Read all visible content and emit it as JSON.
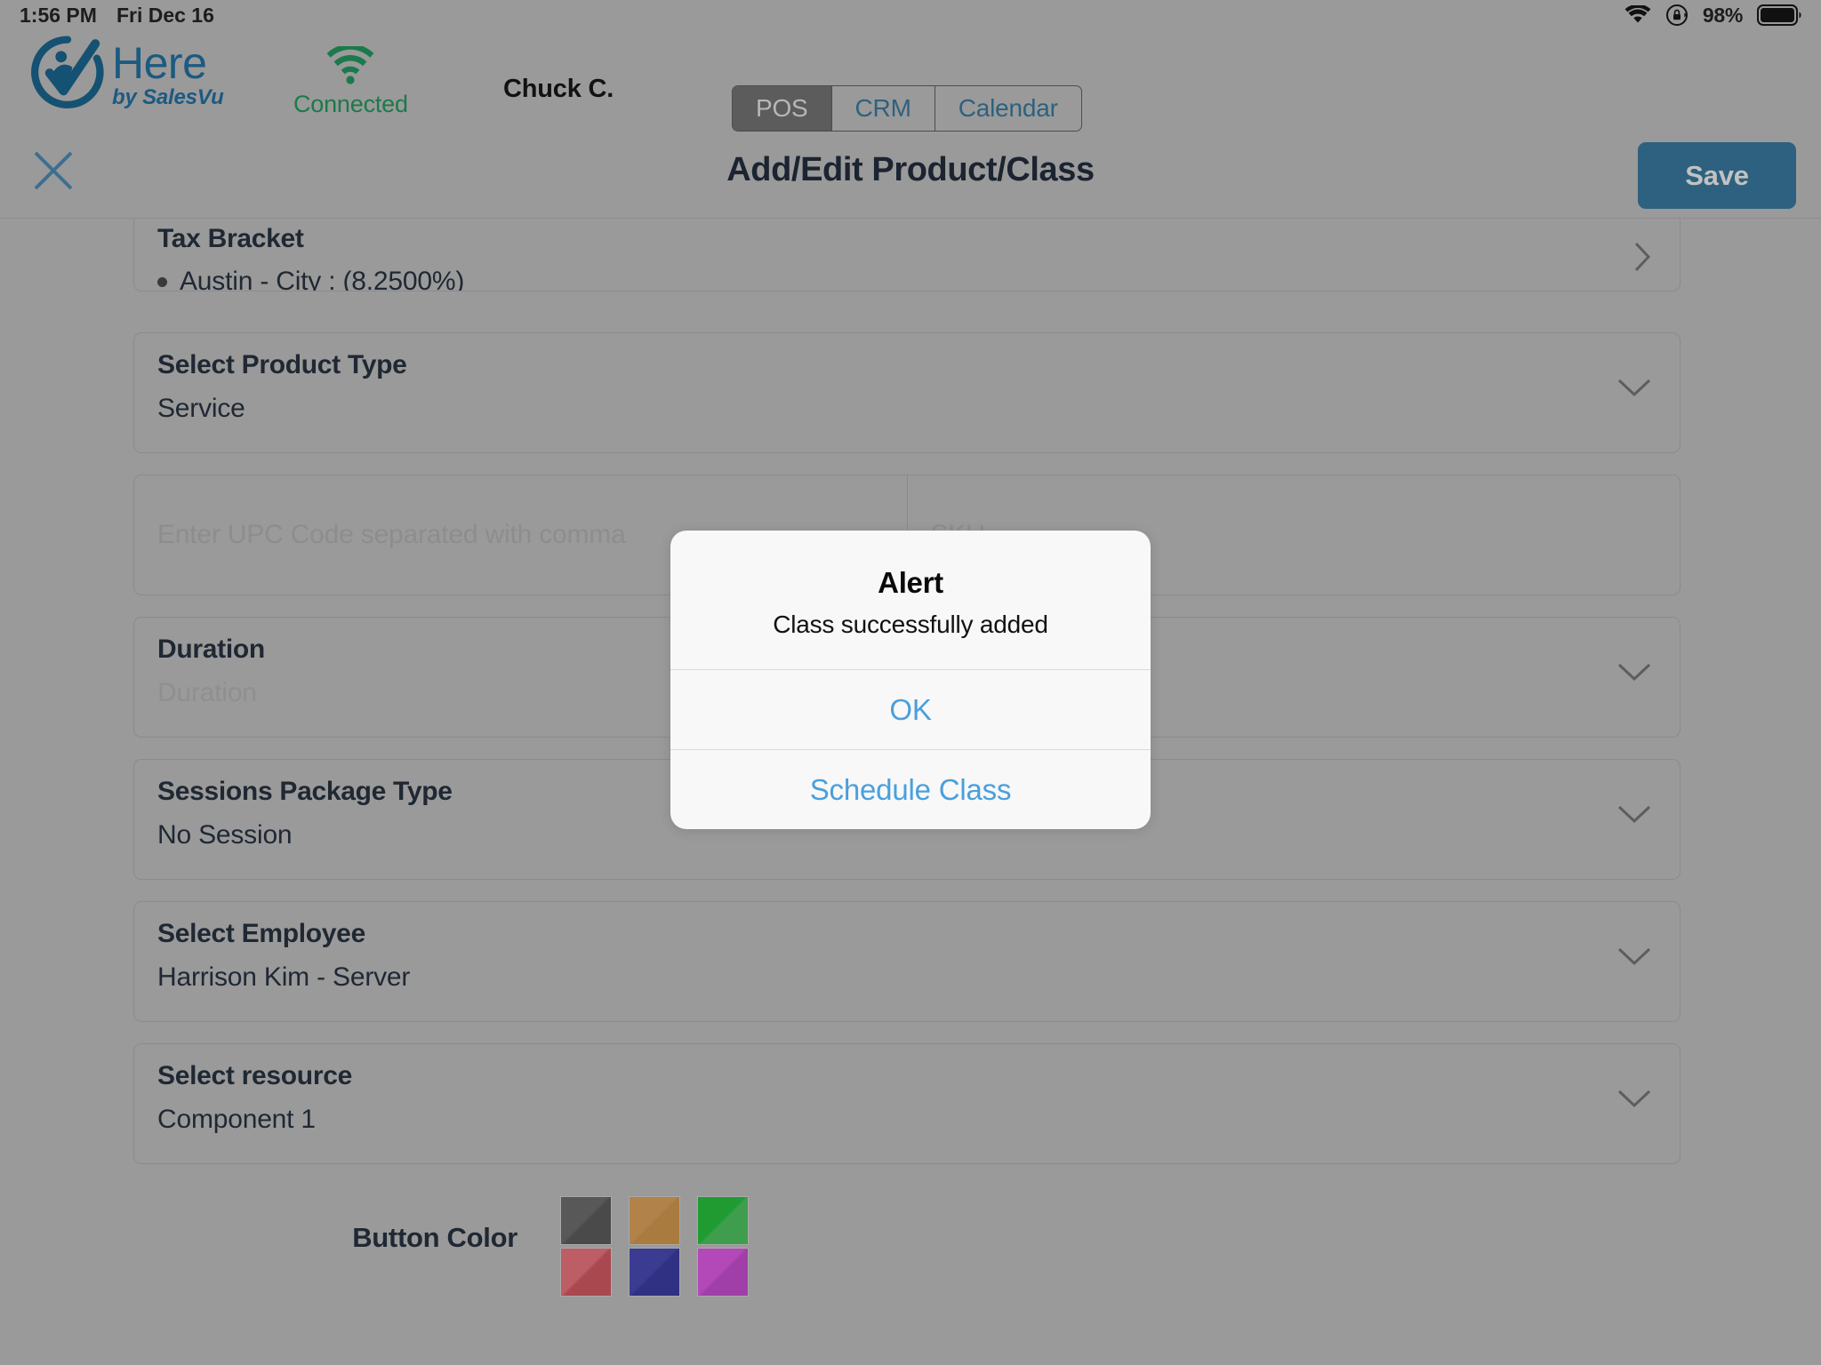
{
  "status_bar": {
    "time": "1:56 PM",
    "date": "Fri Dec 16",
    "wifi_icon": "wifi-icon",
    "rotation_lock_icon": "rotation-lock-icon",
    "battery_percent": "98%",
    "battery_icon": "battery-full-icon"
  },
  "top_bar": {
    "logo_name": "Here",
    "logo_tagline": "by SalesVu",
    "logo_icon": "here-salesvu-logo-icon",
    "connection": {
      "icon": "wifi-signal-icon",
      "label": "Connected",
      "color": "#1b7a4b"
    },
    "user_name": "Chuck C.",
    "segments": [
      {
        "label": "POS",
        "active": true
      },
      {
        "label": "CRM",
        "active": false
      },
      {
        "label": "Calendar",
        "active": false
      }
    ]
  },
  "nav_header": {
    "close_icon": "close-x-icon",
    "title": "Add/Edit Product/Class",
    "save_label": "Save",
    "save_color": "#2d617f"
  },
  "form": {
    "tax_bracket": {
      "label": "Tax Bracket",
      "value": "Austin - City : (8.2500%)",
      "chevron": "chevron-right-icon"
    },
    "product_type": {
      "label": "Select Product Type",
      "value": "Service",
      "chevron": "chevron-down-icon"
    },
    "upc": {
      "placeholder": "Enter UPC Code separated with comma"
    },
    "sku": {
      "placeholder": "SKU"
    },
    "duration": {
      "label": "Duration",
      "placeholder": "Duration",
      "chevron": "chevron-down-icon"
    },
    "sessions_package_type": {
      "label": "Sessions Package Type",
      "value": "No Session",
      "chevron": "chevron-down-icon"
    },
    "employee": {
      "label": "Select Employee",
      "value": "Harrison Kim - Server",
      "chevron": "chevron-down-icon"
    },
    "resource": {
      "label": "Select resource",
      "value": "Component 1",
      "chevron": "chevron-down-icon"
    },
    "button_color": {
      "label": "Button Color",
      "swatches": [
        {
          "name": "swatch-dark-gray",
          "from": "#585858",
          "to": "#4a4a4a"
        },
        {
          "name": "swatch-orange",
          "from": "#b1824a",
          "to": "#a97b3f"
        },
        {
          "name": "swatch-green",
          "from": "#1f9b32",
          "to": "#3f9e4e"
        },
        {
          "name": "swatch-red",
          "from": "#bd5d66",
          "to": "#a9484f"
        },
        {
          "name": "swatch-blue",
          "from": "#3a3b91",
          "to": "#303182"
        },
        {
          "name": "swatch-magenta",
          "from": "#b348b8",
          "to": "#a03fa8"
        }
      ]
    }
  },
  "alert": {
    "title": "Alert",
    "message": "Class successfully added",
    "actions": [
      {
        "label": "OK",
        "name": "alert-ok-button"
      },
      {
        "label": "Schedule Class",
        "name": "alert-schedule-class-button"
      }
    ],
    "link_color": "#4a9fdc"
  }
}
